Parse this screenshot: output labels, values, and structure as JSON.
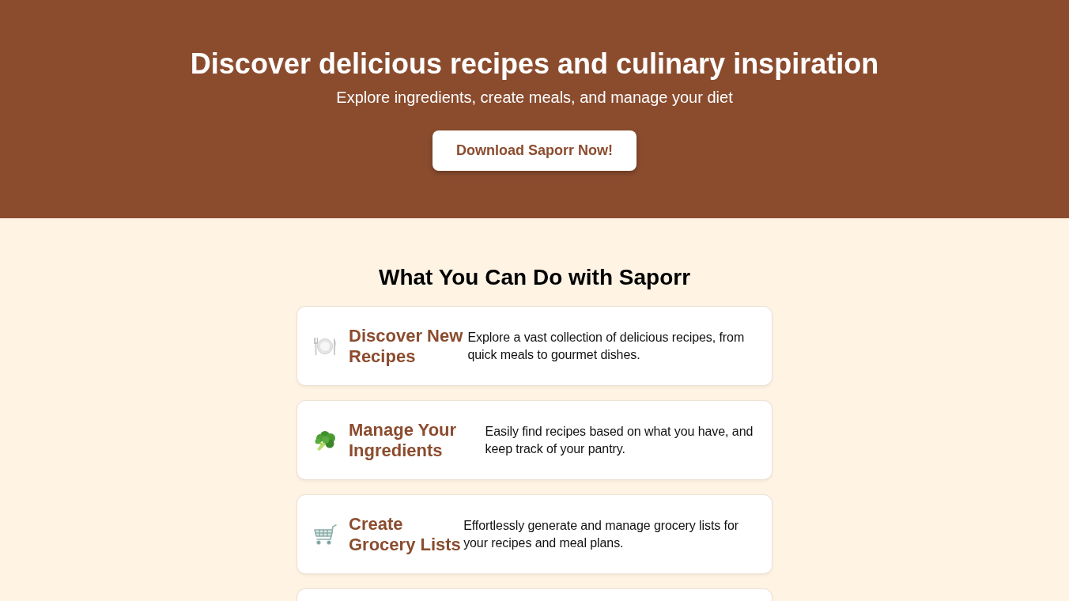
{
  "hero": {
    "title": "Discover delicious recipes and culinary inspiration",
    "subtitle": "Explore ingredients, create meals, and manage your diet",
    "cta_button": "Download Saporr Now!"
  },
  "features": {
    "heading": "What You Can Do with Saporr",
    "items": [
      {
        "title": "Discover New Recipes",
        "description": "Explore a vast collection of delicious recipes, from quick meals to gourmet dishes."
      },
      {
        "title": "Manage Your Ingredients",
        "description": "Easily find recipes based on what you have, and keep track of your pantry."
      },
      {
        "title": "Create Grocery Lists",
        "description": "Effortlessly generate and manage grocery lists for your recipes and meal plans."
      }
    ]
  }
}
